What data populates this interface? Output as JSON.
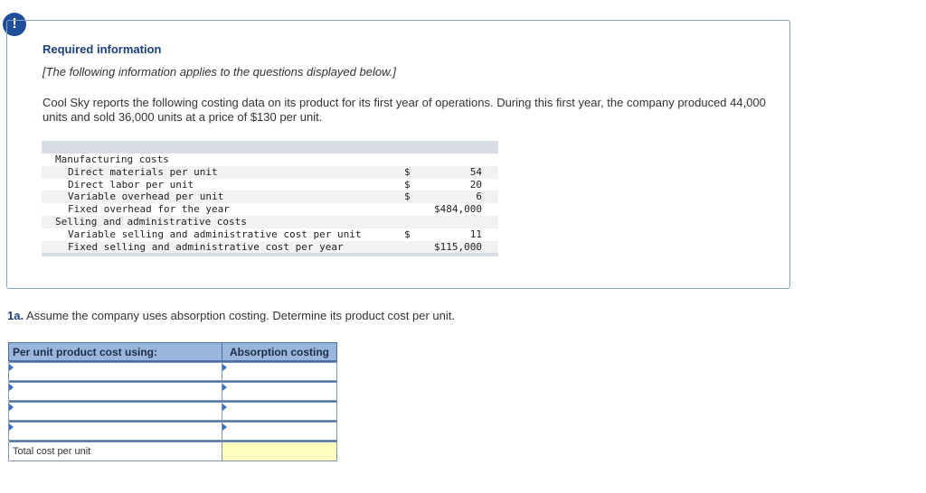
{
  "alert": {
    "symbol": "!"
  },
  "info": {
    "title": "Required information",
    "subtitle": "[The following information applies to the questions displayed below.]",
    "paragraph": "Cool Sky reports the following costing data on its product for its first year of operations. During this first year, the company produced 44,000 units and sold 36,000 units at a price of $130 per unit."
  },
  "costs": {
    "manufacturing_heading": "Manufacturing costs",
    "rows": [
      {
        "label": "Direct materials per unit",
        "dollar": "$",
        "amount": "54"
      },
      {
        "label": "Direct labor per unit",
        "dollar": "$",
        "amount": "20"
      },
      {
        "label": "Variable overhead per unit",
        "dollar": "$",
        "amount": "6"
      },
      {
        "label": "Fixed overhead for the year",
        "dollar": "",
        "amount": "$484,000"
      },
      {
        "label": "Variable selling and administrative cost per unit",
        "dollar": "$",
        "amount": "11"
      },
      {
        "label": "Fixed selling and administrative cost per year",
        "dollar": "",
        "amount": "$115,000"
      }
    ],
    "selling_heading": "Selling and administrative costs"
  },
  "question": {
    "number": "1a.",
    "text": " Assume the company uses absorption costing. Determine its product cost per unit."
  },
  "answer_table": {
    "header_col1": "Per unit product cost using:",
    "header_col2": "Absorption costing",
    "rows": [
      {
        "label": "",
        "value": ""
      },
      {
        "label": "",
        "value": ""
      },
      {
        "label": "",
        "value": ""
      },
      {
        "label": "",
        "value": ""
      }
    ],
    "total_label": "Total cost per unit",
    "total_value": ""
  }
}
